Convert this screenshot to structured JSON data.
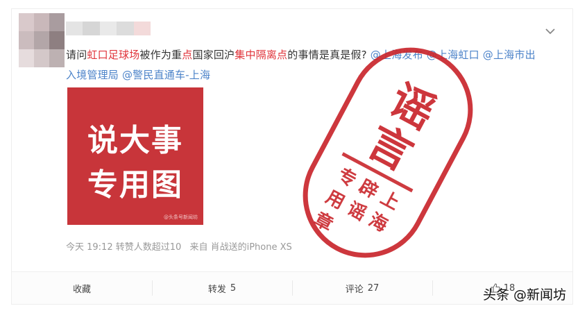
{
  "post": {
    "segments": [
      {
        "text": "请问",
        "style": "plain"
      },
      {
        "text": "虹口足球场",
        "style": "hl"
      },
      {
        "text": "被作为重",
        "style": "plain"
      },
      {
        "text": "点",
        "style": "hl"
      },
      {
        "text": "国家回沪",
        "style": "plain"
      },
      {
        "text": "集中隔离点",
        "style": "hl"
      },
      {
        "text": "的事情是真是假? ",
        "style": "plain"
      },
      {
        "text": "@上海发布",
        "style": "mention"
      },
      {
        "text": " ",
        "style": "plain"
      },
      {
        "text": "@上海虹口",
        "style": "mention"
      },
      {
        "text": " ",
        "style": "plain"
      },
      {
        "text": "@",
        "style": "mention"
      },
      {
        "text": "上海市出入境管理局",
        "style": "mention"
      },
      {
        "text": " ",
        "style": "plain"
      },
      {
        "text": "@警民直通车-上海",
        "style": "mention"
      }
    ],
    "image": {
      "line1": "说大事",
      "line2": "专用图",
      "watermark": "@头条号新闻坊"
    },
    "meta": {
      "time": "今天 19:12",
      "reposts": "转赞人数超过10",
      "source_label": "来自",
      "device": "肖战送的iPhone XS"
    }
  },
  "actions": {
    "favorite": "收藏",
    "repost_label": "转发",
    "repost_count": "5",
    "comment_label": "评论",
    "comment_count": "27",
    "like_count": "18"
  },
  "stamp": {
    "title": "谣言",
    "subtitle": "上海辟谣专用章"
  },
  "brand": "头条 @新闻坊",
  "colors": {
    "highlight": "#e0333a",
    "mention": "#4c83c9",
    "stamp": "#c9262c",
    "thumb": "#c8353a"
  },
  "icons": [
    "chevron-down-icon",
    "thumbs-up-icon"
  ]
}
